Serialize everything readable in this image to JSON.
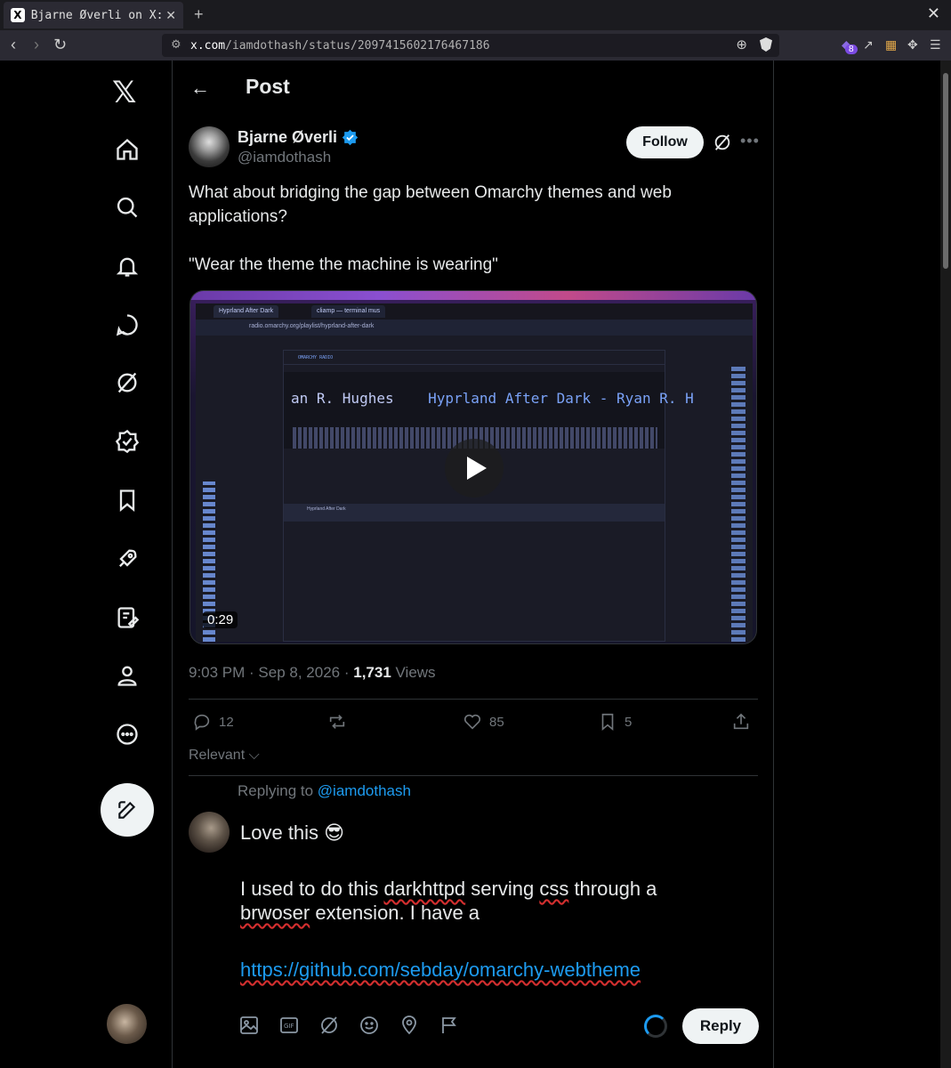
{
  "browser": {
    "tab_title": "Bjarne Øverli on X:",
    "tab_favicon": "X",
    "url_host": "x.com",
    "url_path": "/iamdothash/status/2097415602176467186",
    "extension_badge": "8"
  },
  "header": {
    "title": "Post"
  },
  "post": {
    "author_name": "Bjarne Øverli",
    "author_handle": "@iamdothash",
    "follow_label": "Follow",
    "text_line1": "What about bridging the gap between Omarchy themes and web",
    "text_line2": "applications?",
    "text_line3": "\"Wear the theme the machine is wearing\"",
    "video_duration": "0:29",
    "video_tab1": "Hyprland After Dark",
    "video_tab2": "cliamp — terminal mus",
    "video_url": "radio.omarchy.org/playlist/hyprland-after-dark",
    "video_app_title": "OMARCHY RADIO",
    "video_marquee_a": "an R. Hughes",
    "video_marquee_b": "Hyprland After Dark - Ryan R. H",
    "video_track": "Hyprland After Dark",
    "time": "9:03 PM",
    "date": "Sep 8, 2026",
    "views_count": "1,731",
    "views_label": "Views",
    "replies": "12",
    "likes": "85",
    "bookmarks": "5"
  },
  "sort_label": "Relevant",
  "reply_compose": {
    "replying_to_label": "Replying to",
    "replying_to_handle": "@iamdothash",
    "line1": "Love this 😎",
    "line2": "I used to do this darkhttpd serving css through a",
    "line3_word": "brwoser",
    "line3_rest": " extension. I have a",
    "link": "https://github.com/sebday/omarchy-webtheme",
    "reply_button": "Reply"
  },
  "colors": {
    "accent": "#1d9bf0",
    "background": "#000000",
    "text": "#e7e9ea",
    "muted": "#71767b",
    "verified": "#1d9bf0"
  }
}
